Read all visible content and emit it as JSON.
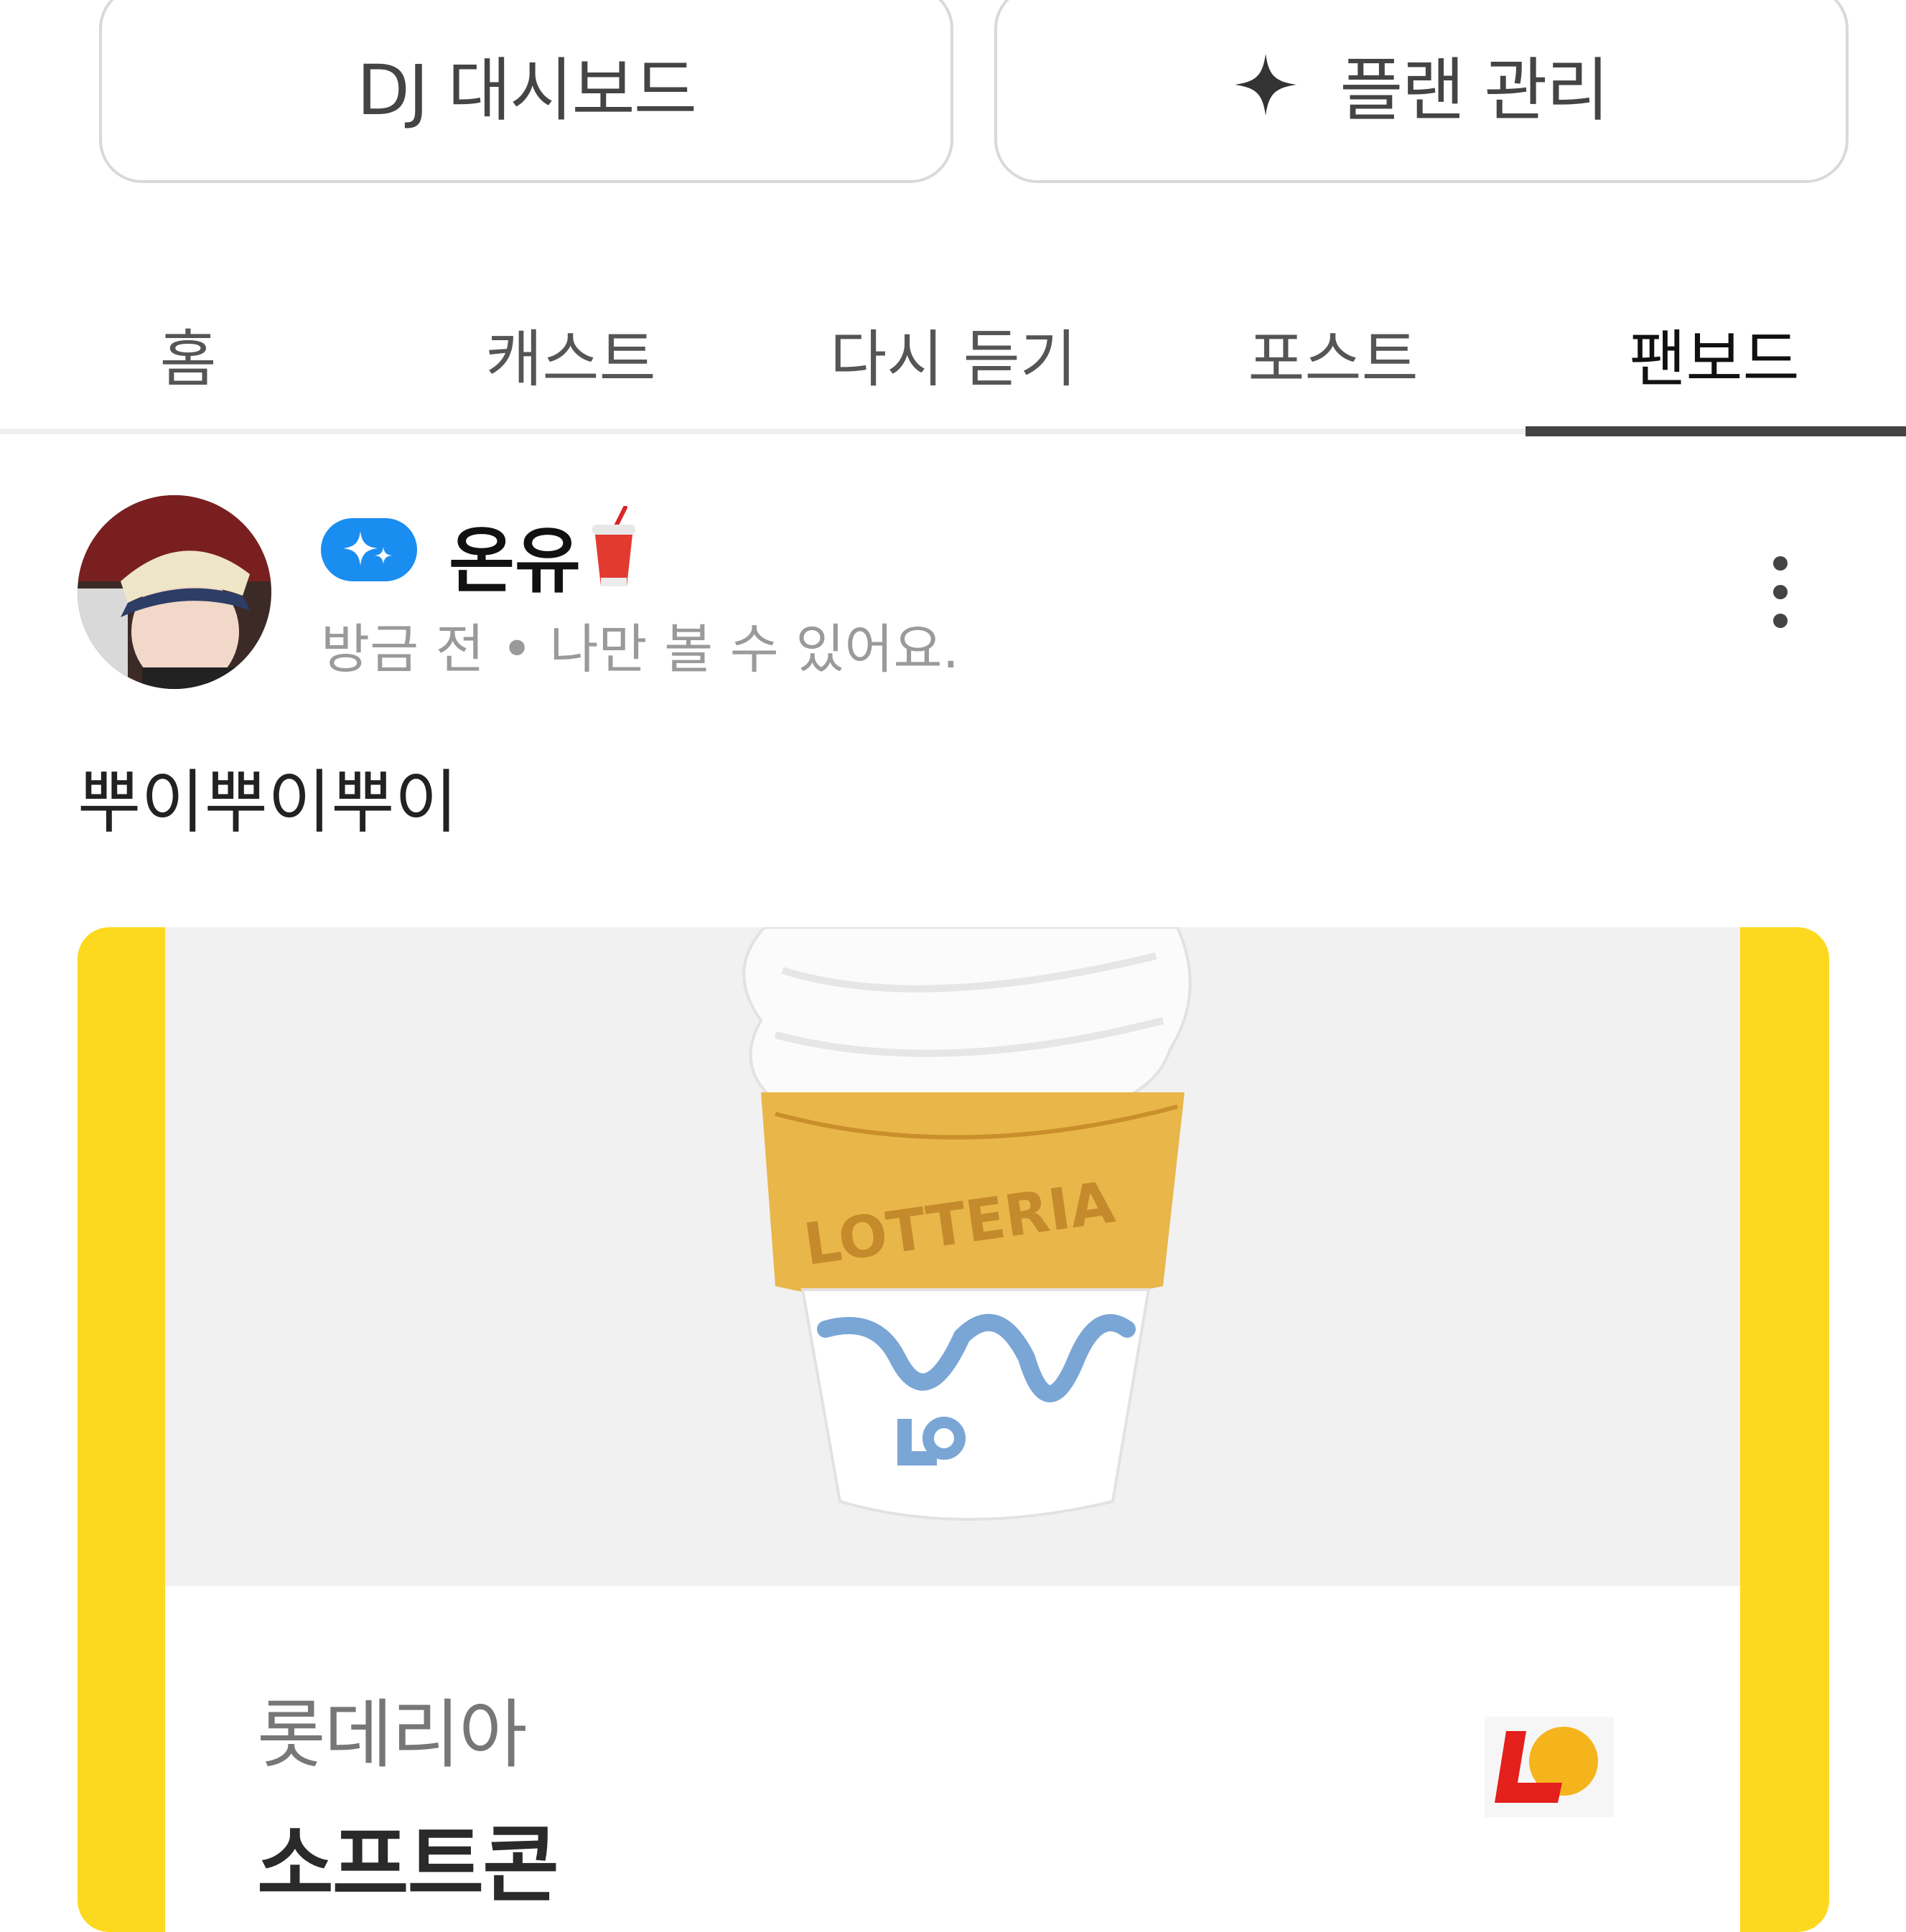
{
  "top_buttons": {
    "dj_dashboard": "DJ 대시보드",
    "plan_manage": "플랜 관리"
  },
  "tabs": [
    {
      "label": "홈",
      "active": false
    },
    {
      "label": "캐스트",
      "active": false
    },
    {
      "label": "다시 듣기",
      "active": false
    },
    {
      "label": "포스트",
      "active": false
    },
    {
      "label": "팬보드",
      "active": true
    }
  ],
  "post": {
    "author": "온유",
    "meta": "방금 전 • 나만 볼 수 있어요.",
    "text": "뿌이뿌이뿌이"
  },
  "gift_card": {
    "brand": "롯데리아",
    "product": "소프트콘",
    "cone_text": "LOTTERIA"
  },
  "colors": {
    "card_border": "#fcd91e",
    "badge": "#1a8df0",
    "active_tab_underline": "#444444"
  },
  "icons": [
    "sparkle-icon",
    "verified-sparkle-badge-icon",
    "drink-cup-icon",
    "more-vertical-icon",
    "lotteria-logo-icon"
  ]
}
